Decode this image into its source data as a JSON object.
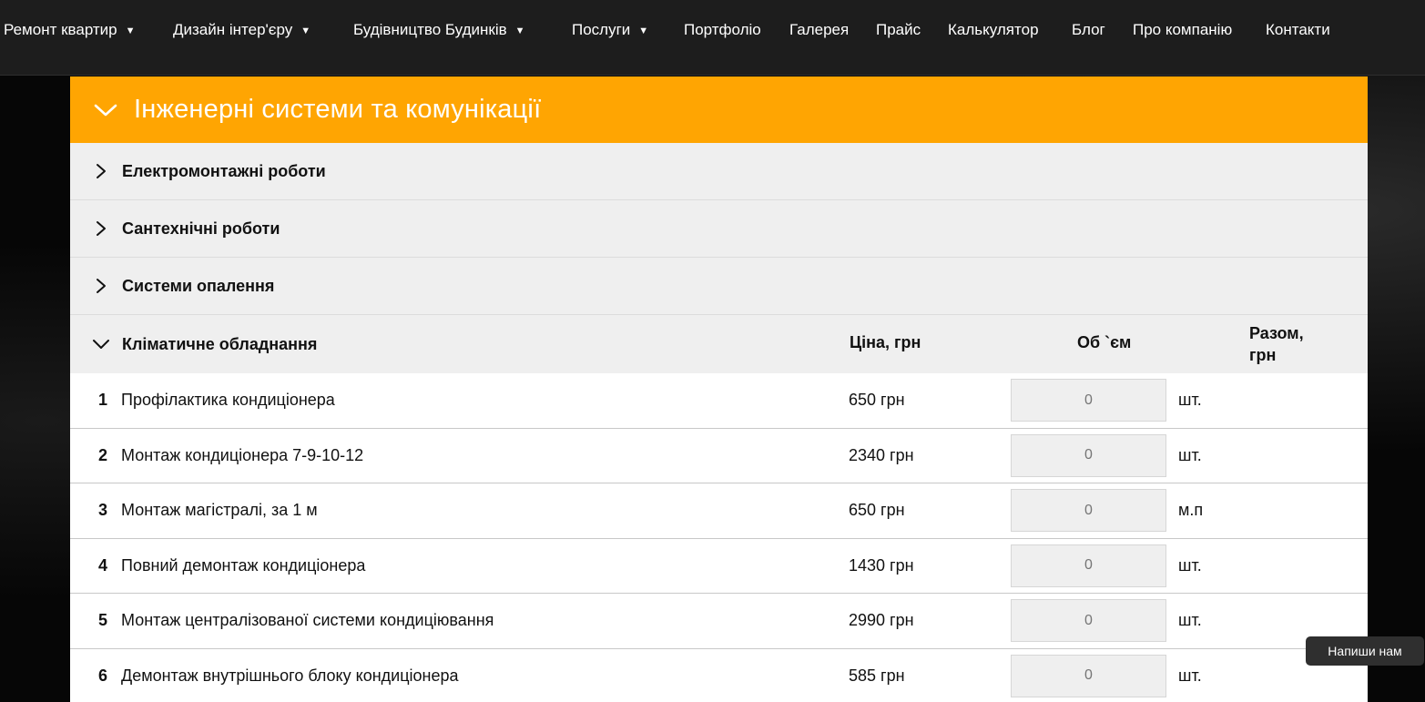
{
  "nav": [
    {
      "label": "Ремонт квартир",
      "dropdown": true
    },
    {
      "label": "Дизайн інтер'єру",
      "dropdown": true
    },
    {
      "label": "Будівництво Будинків",
      "dropdown": true
    },
    {
      "label": "Послуги",
      "dropdown": true
    },
    {
      "label": "Портфоліо",
      "dropdown": false
    },
    {
      "label": "Галерея",
      "dropdown": false
    },
    {
      "label": "Прайс",
      "dropdown": false
    },
    {
      "label": "Калькулятор",
      "dropdown": false
    },
    {
      "label": "Блог",
      "dropdown": false
    },
    {
      "label": "Про компанію",
      "dropdown": false
    },
    {
      "label": "Контакти",
      "dropdown": false
    }
  ],
  "nav_caret": "▼",
  "section": {
    "title": "Інженерні системи та комунікації",
    "accent_color": "#ffa502",
    "icon": "chevron-down-icon"
  },
  "subsections": [
    {
      "label": "Електромонтажні роботи",
      "icon": "chevron-right-icon"
    },
    {
      "label": "Сантехнічні роботи",
      "icon": "chevron-right-icon"
    },
    {
      "label": "Системи опалення",
      "icon": "chevron-right-icon"
    }
  ],
  "table": {
    "title": "Кліматичне обладнання",
    "col_price": "Ціна, грн",
    "col_volume": "Об `єм",
    "col_total": "Разом, грн",
    "rows": [
      {
        "num": "1",
        "name": "Профілактика кондиціонера",
        "price": "650 грн",
        "value": "0",
        "unit": "шт."
      },
      {
        "num": "2",
        "name": "Монтаж кондиціонера 7-9-10-12",
        "price": "2340 грн",
        "value": "0",
        "unit": "шт."
      },
      {
        "num": "3",
        "name": "Монтаж магістралі, за 1 м",
        "price": "650 грн",
        "value": "0",
        "unit": "м.п"
      },
      {
        "num": "4",
        "name": "Повний демонтаж кондиціонера",
        "price": "1430 грн",
        "value": "0",
        "unit": "шт."
      },
      {
        "num": "5",
        "name": "Монтаж централізованої системи кондиціювання",
        "price": "2990 грн",
        "value": "0",
        "unit": "шт."
      },
      {
        "num": "6",
        "name": "Демонтаж внутрішнього блоку кондиціонера",
        "price": "585 грн",
        "value": "0",
        "unit": "шт."
      }
    ]
  },
  "chat_button": "Напиши нам"
}
